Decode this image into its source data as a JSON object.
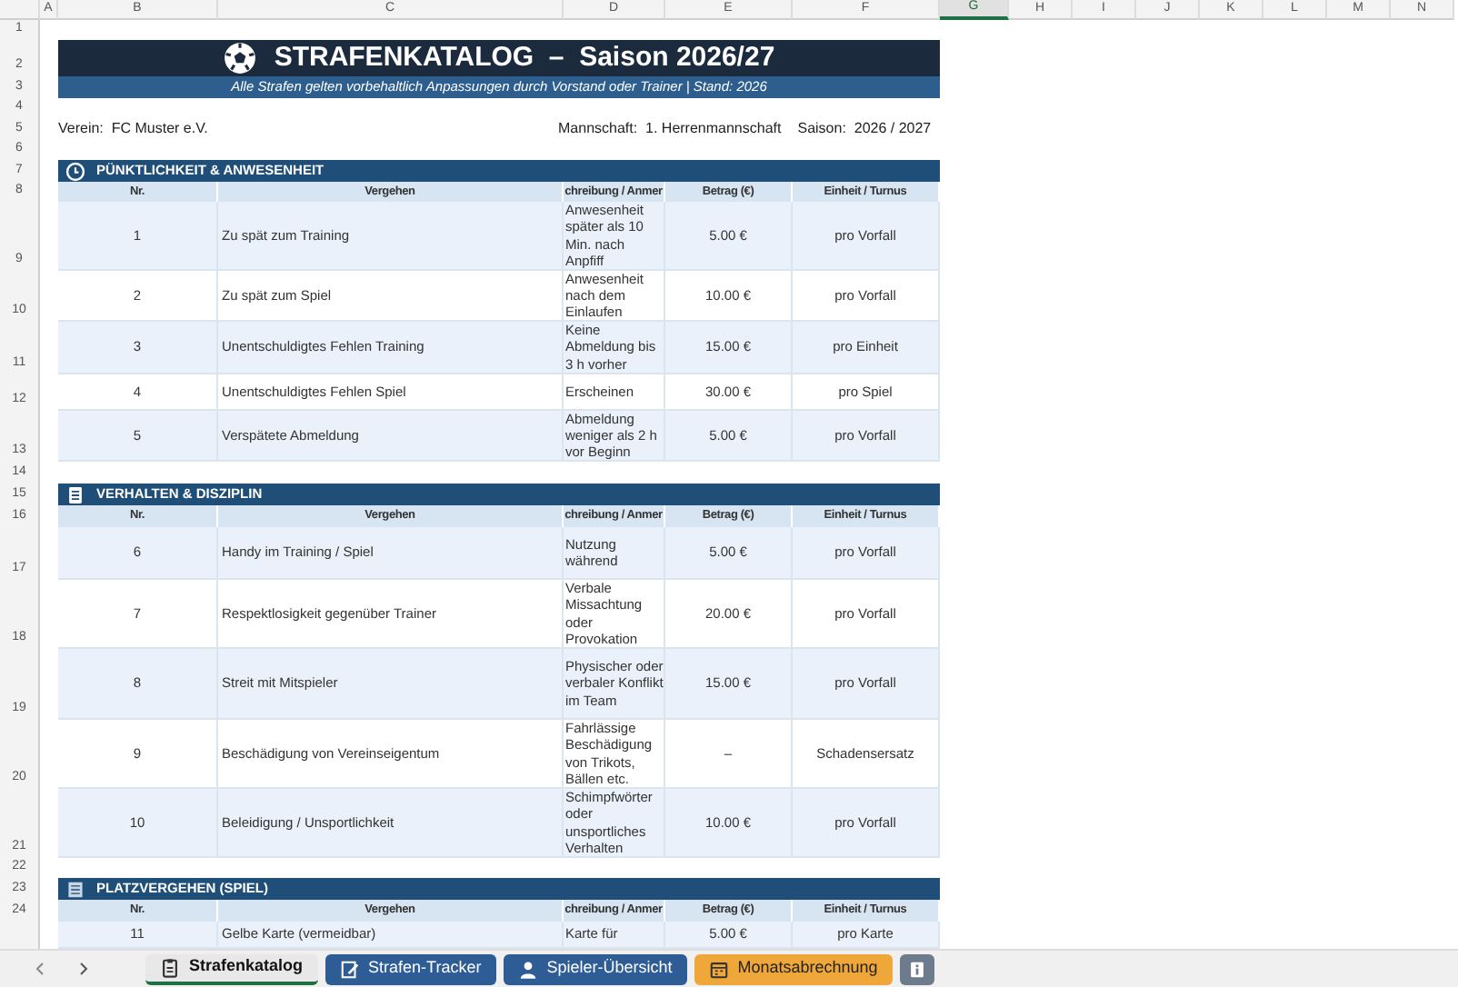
{
  "column_headers": [
    {
      "label": "A",
      "selected": false
    },
    {
      "label": "B",
      "selected": false
    },
    {
      "label": "C",
      "selected": false
    },
    {
      "label": "D",
      "selected": false
    },
    {
      "label": "E",
      "selected": false
    },
    {
      "label": "F",
      "selected": false
    },
    {
      "label": "G",
      "selected": true
    },
    {
      "label": "H",
      "selected": false
    },
    {
      "label": "I",
      "selected": false
    },
    {
      "label": "J",
      "selected": false
    },
    {
      "label": "K",
      "selected": false
    },
    {
      "label": "L",
      "selected": false
    },
    {
      "label": "M",
      "selected": false
    },
    {
      "label": "N",
      "selected": false
    }
  ],
  "row_numbers": [
    "1",
    "2",
    "3",
    "4",
    "5",
    "6",
    "7",
    "8",
    "9",
    "10",
    "11",
    "12",
    "13",
    "14",
    "15",
    "16",
    "17",
    "18",
    "19",
    "20",
    "21",
    "22",
    "23",
    "24"
  ],
  "title": "STRAFENKATALOG  –  Saison 2026/27",
  "subtitle": "Alle Strafen gelten vorbehaltlich Anpassungen durch Vorstand oder Trainer | Stand: 2026",
  "info": {
    "club": "Verein:  FC Muster e.V.",
    "team": "Mannschaft:  1. Herrenmannschaft",
    "season": "Saison:  2026 / 2027"
  },
  "sections": [
    {
      "title": "PÜNKTLICHKEIT & ANWESENHEIT",
      "columns": [
        "Nr.",
        "Vergehen",
        "chreibung / Anmer",
        "Betrag (€)",
        "Einheit / Turnus"
      ],
      "rows": [
        {
          "nr": "1",
          "offense": "Zu spät zum Training",
          "description": "Anwesenheit später als 10 Min. nach Anpfiff",
          "amount": "5.00 €",
          "unit": "pro Vorfall"
        },
        {
          "nr": "2",
          "offense": "Zu spät zum Spiel",
          "description": "Anwesenheit nach dem Einlaufen",
          "amount": "10.00 €",
          "unit": "pro Vorfall"
        },
        {
          "nr": "3",
          "offense": "Unentschuldigtes Fehlen Training",
          "description": "Keine Abmeldung bis 3 h vorher",
          "amount": "15.00 €",
          "unit": "pro Einheit"
        },
        {
          "nr": "4",
          "offense": "Unentschuldigtes Fehlen Spiel",
          "description": "Erscheinen",
          "amount": "30.00 €",
          "unit": "pro Spiel"
        },
        {
          "nr": "5",
          "offense": "Verspätete Abmeldung",
          "description": "Abmeldung weniger als 2 h vor Beginn",
          "amount": "5.00 €",
          "unit": "pro Vorfall"
        }
      ]
    },
    {
      "title": "VERHALTEN & DISZIPLIN",
      "columns": [
        "Nr.",
        "Vergehen",
        "chreibung / Anmer",
        "Betrag (€)",
        "Einheit / Turnus"
      ],
      "rows": [
        {
          "nr": "6",
          "offense": "Handy im Training / Spiel",
          "description": "Nutzung während",
          "amount": "5.00 €",
          "unit": "pro Vorfall"
        },
        {
          "nr": "7",
          "offense": "Respektlosigkeit gegenüber Trainer",
          "description": "Verbale Missachtung oder Provokation",
          "amount": "20.00 €",
          "unit": "pro Vorfall"
        },
        {
          "nr": "8",
          "offense": "Streit mit Mitspieler",
          "description": "Physischer oder verbaler Konflikt im Team",
          "amount": "15.00 €",
          "unit": "pro Vorfall"
        },
        {
          "nr": "9",
          "offense": "Beschädigung von Vereinseigentum",
          "description": "Fahrlässige Beschädigung von Trikots, Bällen etc.",
          "amount": "–",
          "unit": "Schadensersatz"
        },
        {
          "nr": "10",
          "offense": "Beleidigung / Unsportlichkeit",
          "description": "Schimpfwörter oder unsportliches Verhalten",
          "amount": "10.00 €",
          "unit": "pro Vorfall"
        }
      ]
    },
    {
      "title": "PLATZVERGEHEN (SPIEL)",
      "columns": [
        "Nr.",
        "Vergehen",
        "chreibung / Anmer",
        "Betrag (€)",
        "Einheit / Turnus"
      ],
      "rows": [
        {
          "nr": "11",
          "offense": "Gelbe Karte (vermeidbar)",
          "description": "Karte für",
          "amount": "5.00 €",
          "unit": "pro Karte"
        }
      ]
    }
  ],
  "sheet_tabs": [
    {
      "label": "Strafenkatalog",
      "selected": true,
      "color": "#e8e8e8"
    },
    {
      "label": "Strafen-Tracker",
      "selected": false,
      "color": "#2e5c94"
    },
    {
      "label": "Spieler-Übersicht",
      "selected": false,
      "color": "#2e5c94"
    },
    {
      "label": "Monatsabrechnung",
      "selected": false,
      "color": "#f0a73a"
    },
    {
      "selected": false,
      "color": "#6d7b8c"
    }
  ]
}
